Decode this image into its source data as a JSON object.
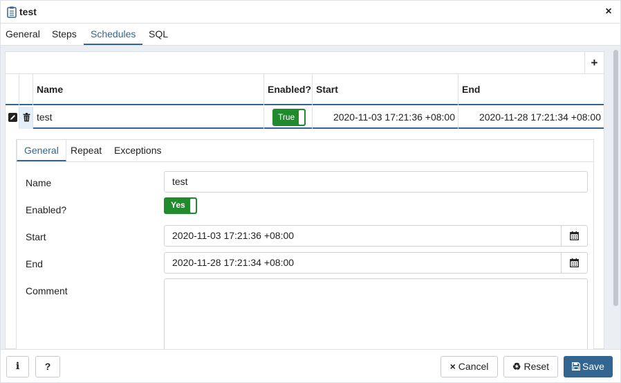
{
  "dialog": {
    "title": "test",
    "close_glyph": "×"
  },
  "tabs": [
    {
      "label": "General"
    },
    {
      "label": "Steps"
    },
    {
      "label": "Schedules",
      "active": true
    },
    {
      "label": "SQL"
    }
  ],
  "grid": {
    "add_glyph": "+",
    "columns": [
      "Name",
      "Enabled?",
      "Start",
      "End"
    ],
    "rows": [
      {
        "name": "test",
        "enabled": "True",
        "start": "2020-11-03 17:21:36 +08:00",
        "end": "2020-11-28 17:21:34 +08:00"
      }
    ]
  },
  "subtabs": [
    {
      "label": "General",
      "active": true
    },
    {
      "label": "Repeat"
    },
    {
      "label": "Exceptions"
    }
  ],
  "form": {
    "name_label": "Name",
    "name_value": "test",
    "enabled_label": "Enabled?",
    "enabled_value": "Yes",
    "start_label": "Start",
    "start_value": "2020-11-03 17:21:36 +08:00",
    "end_label": "End",
    "end_value": "2020-11-28 17:21:34 +08:00",
    "comment_label": "Comment",
    "comment_value": ""
  },
  "footer": {
    "info_glyph": "i",
    "help_glyph": "?",
    "cancel_label": "Cancel",
    "cancel_glyph": "×",
    "reset_label": "Reset",
    "reset_glyph": "♻",
    "save_label": "Save"
  },
  "colors": {
    "accent": "#326690",
    "toggle_on": "#1f8b2d",
    "panel_bg": "#ebeef3"
  }
}
